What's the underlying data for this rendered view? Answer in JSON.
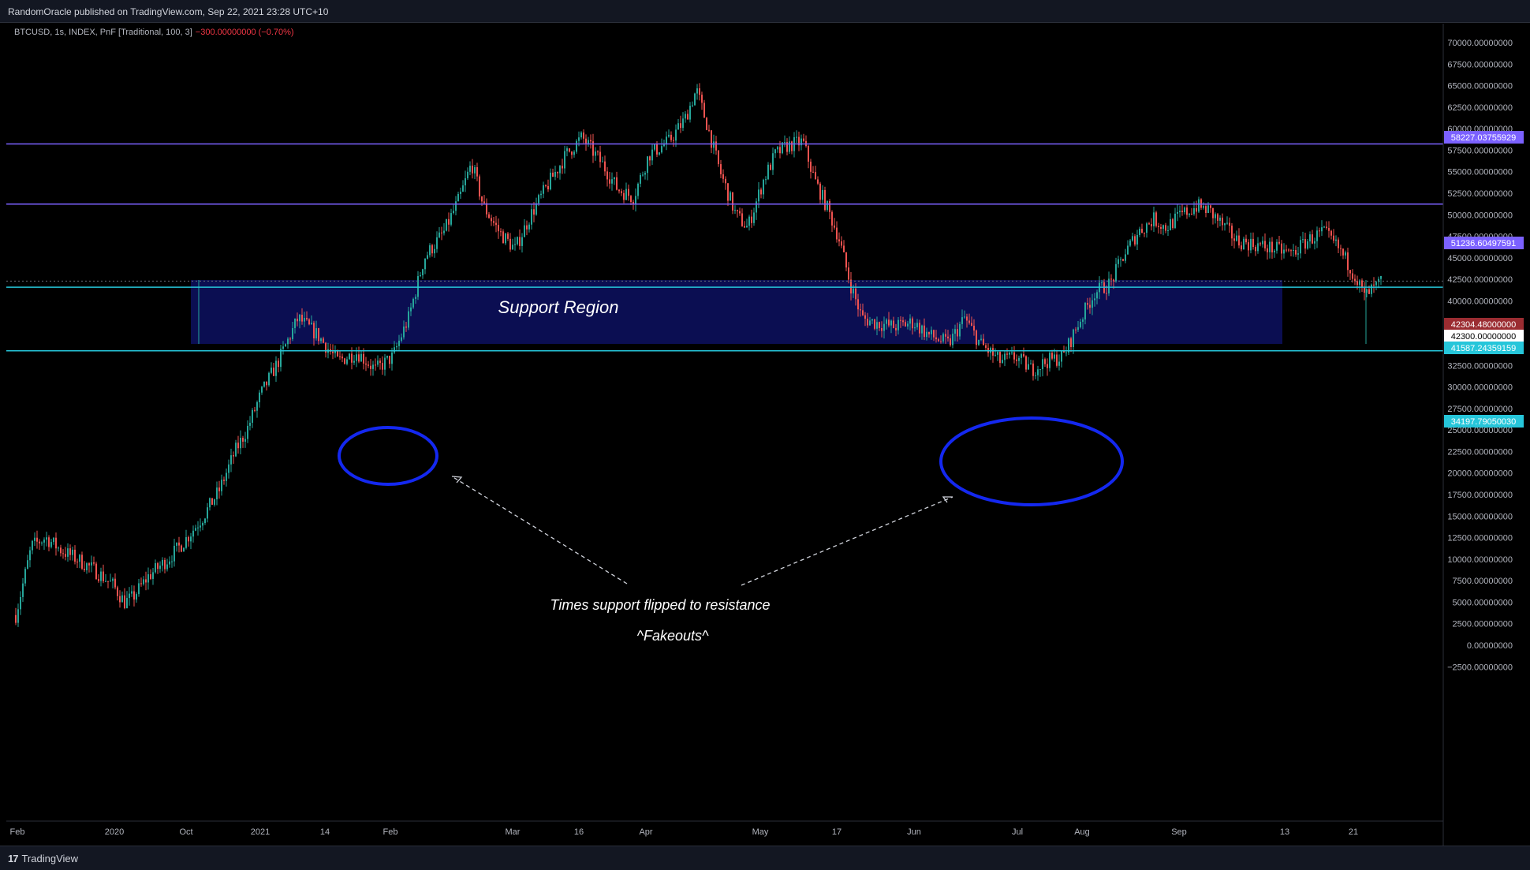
{
  "header": {
    "published_text": "RandomOracle published on TradingView.com, Sep 22, 2021 23:28 UTC+10"
  },
  "legend": {
    "symbol_text": "BTCUSD, 1s, INDEX, PnF [Traditional, 100, 3]",
    "change_text": "−300.00000000 (−0.70%)"
  },
  "footer": {
    "logo_text": "TradingView",
    "logo_icon": "tradingview-logo-icon"
  },
  "colors": {
    "background": "#000000",
    "up": "#26a69a",
    "down": "#ef5350",
    "purple_line": "#7b61ff",
    "cyan_line": "#26c6da",
    "support_fill": "#0d1060",
    "annotation_blue": "#1428f0"
  },
  "chart_data": {
    "type": "line",
    "title": "",
    "xlabel": "",
    "ylabel": "",
    "ylim": [
      -2500,
      72500
    ],
    "y_ticks": [
      "70000.00000000",
      "67500.00000000",
      "65000.00000000",
      "62500.00000000",
      "60000.00000000",
      "57500.00000000",
      "55000.00000000",
      "52500.00000000",
      "50000.00000000",
      "47500.00000000",
      "45000.00000000",
      "42500.00000000",
      "40000.00000000",
      "37500.00000000",
      "35000.00000000",
      "32500.00000000",
      "30000.00000000",
      "27500.00000000",
      "25000.00000000",
      "22500.00000000",
      "20000.00000000",
      "17500.00000000",
      "15000.00000000",
      "12500.00000000",
      "10000.00000000",
      "7500.00000000",
      "5000.00000000",
      "2500.00000000",
      "0.00000000",
      "−2500.00000000"
    ],
    "x_tick_labels": [
      "Feb",
      "2020",
      "Oct",
      "2021",
      "14",
      "Feb",
      "Mar",
      "16",
      "Apr",
      "May",
      "17",
      "Jun",
      "Jul",
      "Aug",
      "Sep",
      "13",
      "21"
    ],
    "series": [
      {
        "x": [
          "Feb",
          "2020",
          "Oct",
          "2021",
          "14",
          "Feb",
          "Mar",
          "16",
          "Apr",
          "May",
          "17",
          "Jun",
          "Jul",
          "Aug",
          "Sep",
          "13",
          "21"
        ],
        "y": [
          3500,
          5000,
          15000,
          30000,
          33000,
          38000,
          55000,
          60000,
          63000,
          57000,
          40000,
          35000,
          31000,
          40000,
          51000,
          46000,
          42300
        ]
      }
    ],
    "price_labels": [
      {
        "value": 58227.03755929,
        "text": "58227.03755929",
        "color": "#7b61ff"
      },
      {
        "value": 51236.60497591,
        "text": "51236.60497591",
        "color": "#7b61ff"
      },
      {
        "value": 42304.48,
        "text": "42304.48000000",
        "color": "#9b2c31"
      },
      {
        "value": 42300,
        "text": "42300.00000000",
        "color": "#ffffff"
      },
      {
        "value": 41587.24359159,
        "text": "41587.24359159",
        "color": "#26c6da"
      },
      {
        "value": 34197.7905003,
        "text": "34197.79050030",
        "color": "#26c6da"
      }
    ],
    "support_region": {
      "low": 34197.7905003,
      "high": 41587.24359159,
      "label": "Support Region"
    },
    "annotations": {
      "fakeout_caption": "Times support flipped to resistance",
      "fakeout_sub": "^Fakeouts^"
    },
    "grid": false
  }
}
